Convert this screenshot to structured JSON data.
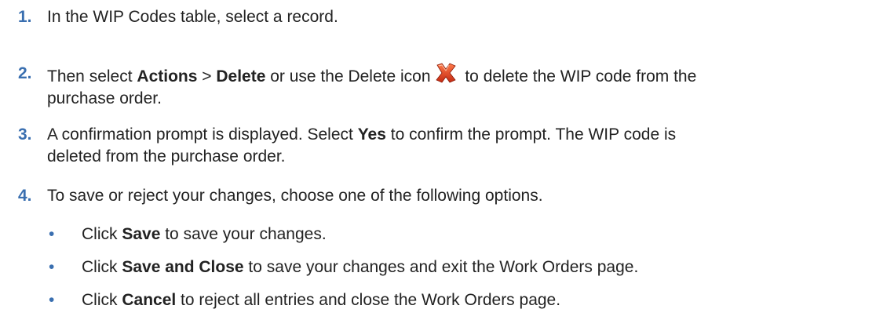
{
  "steps": [
    {
      "number": "1.",
      "text": "In the WIP Codes table, select a record."
    },
    {
      "number": "2.",
      "pre": "Then select ",
      "bold1": "Actions",
      "mid": " > ",
      "bold2": "Delete",
      "post_icon_pre": " or use the Delete icon",
      "icon": "delete-x-icon",
      "post": " to delete the WIP code from the",
      "line2": "purchase order."
    },
    {
      "number": "3.",
      "pre": "A confirmation prompt is displayed. Select ",
      "bold": "Yes",
      "post": " to confirm the prompt. The WIP code is",
      "line2": "deleted from the purchase order."
    },
    {
      "number": "4.",
      "text": "To save or reject your changes, choose one of the following options."
    }
  ],
  "bullets": [
    {
      "bullet": "•",
      "pre": "Click ",
      "bold": "Save",
      "post": " to save your changes."
    },
    {
      "bullet": "•",
      "pre": "Click ",
      "bold": "Save and Close",
      "post": " to save your changes and exit the Work Orders page."
    },
    {
      "bullet": "•",
      "pre": "Click ",
      "bold": "Cancel",
      "post": " to reject all entries and close the Work Orders page."
    }
  ],
  "colors": {
    "number_blue": "#3a6fb0",
    "text": "#222222",
    "icon_red": "#d63a1e"
  }
}
